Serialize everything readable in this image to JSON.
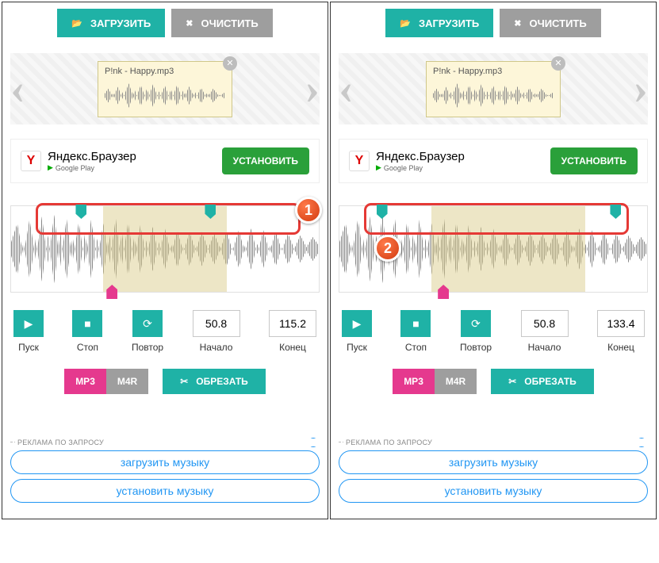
{
  "toolbar": {
    "load": "ЗАГРУЗИТЬ",
    "clear": "ОЧИСТИТЬ"
  },
  "file": {
    "name": "P!nk - Happy.mp3"
  },
  "ad": {
    "title": "Яндекс.Браузер",
    "store": "Google Play",
    "cta": "УСТАНОВИТЬ"
  },
  "controls": {
    "play": "Пуск",
    "stop": "Стоп",
    "repeat": "Повтор",
    "start": "Начало",
    "end": "Конец"
  },
  "format": {
    "mp3": "MP3",
    "m4r": "M4R",
    "cut": "ОБРЕЗАТЬ"
  },
  "promo": {
    "header": "РЕКЛАМА ПО ЗАПРОСУ",
    "link1": "загрузить музыку",
    "link2": "установить музыку"
  },
  "panels": [
    {
      "badge": "1",
      "start": "50.8",
      "end": "115.2",
      "selLeft": 30,
      "selRight": 70,
      "hL": 21,
      "hR": 63,
      "pink": 31,
      "badgeTop": -12,
      "badgeRight": -4
    },
    {
      "badge": "2",
      "start": "50.8",
      "end": "133.4",
      "selLeft": 30,
      "selRight": 80,
      "hL": 12,
      "hR": 88,
      "pink": 32,
      "badgeTop": 36,
      "badgeLeft": 44
    }
  ]
}
